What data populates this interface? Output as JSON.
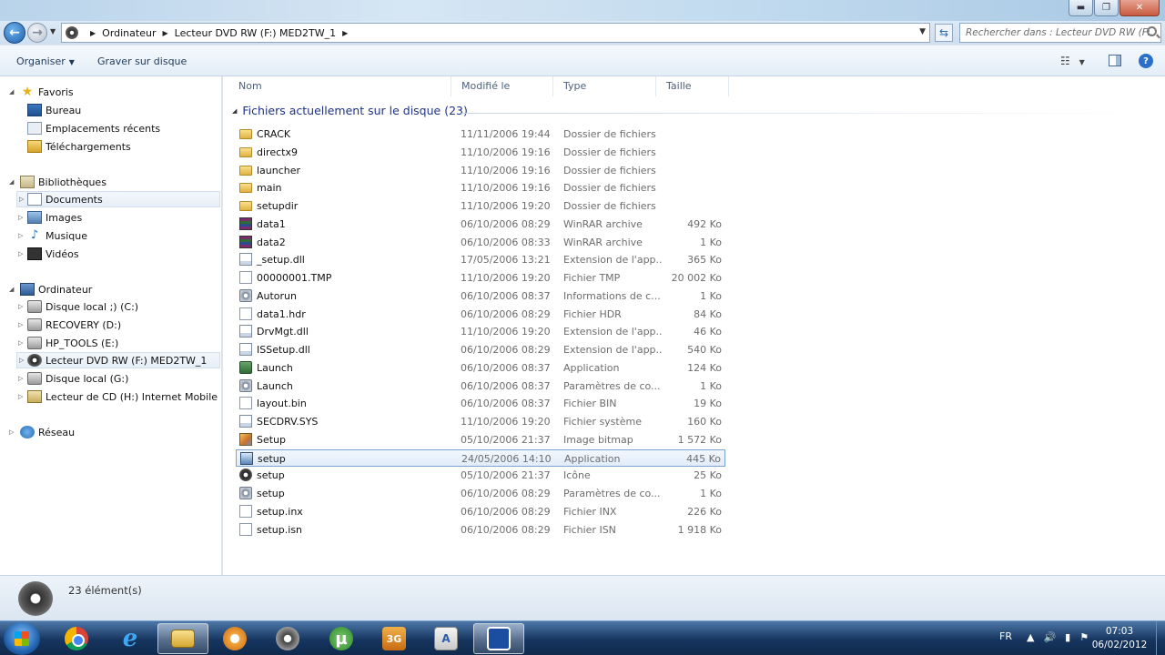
{
  "window": {
    "title_buttons": [
      "minimize",
      "maximize",
      "close"
    ]
  },
  "nav": {
    "breadcrumb": [
      "Ordinateur",
      "Lecteur DVD RW (F:) MED2TW_1"
    ],
    "search_placeholder": "Rechercher dans : Lecteur DVD RW (F:..."
  },
  "toolbar": {
    "organize_label": "Organiser",
    "burn_label": "Graver sur disque"
  },
  "sidebar": {
    "favorites": {
      "label": "Favoris",
      "items": [
        "Bureau",
        "Emplacements récents",
        "Téléchargements"
      ]
    },
    "libraries": {
      "label": "Bibliothèques",
      "items": [
        "Documents",
        "Images",
        "Musique",
        "Vidéos"
      ]
    },
    "computer": {
      "label": "Ordinateur",
      "items": [
        "Disque local ;) (C:)",
        "RECOVERY (D:)",
        "HP_TOOLS (E:)",
        "Lecteur DVD RW (F:) MED2TW_1",
        "Disque local (G:)",
        "Lecteur de CD (H:) Internet Mobile"
      ]
    },
    "network": {
      "label": "Réseau"
    }
  },
  "columns": {
    "name": "Nom",
    "modified": "Modifié le",
    "type": "Type",
    "size": "Taille"
  },
  "group": {
    "label": "Fichiers actuellement sur le disque (23)"
  },
  "files": [
    {
      "name": "CRACK",
      "date": "11/11/2006 19:44",
      "type": "Dossier de fichiers",
      "size": "",
      "icon": "folder"
    },
    {
      "name": "directx9",
      "date": "11/10/2006 19:16",
      "type": "Dossier de fichiers",
      "size": "",
      "icon": "folder"
    },
    {
      "name": "launcher",
      "date": "11/10/2006 19:16",
      "type": "Dossier de fichiers",
      "size": "",
      "icon": "folder"
    },
    {
      "name": "main",
      "date": "11/10/2006 19:16",
      "type": "Dossier de fichiers",
      "size": "",
      "icon": "folder"
    },
    {
      "name": "setupdir",
      "date": "11/10/2006 19:20",
      "type": "Dossier de fichiers",
      "size": "",
      "icon": "folder"
    },
    {
      "name": "data1",
      "date": "06/10/2006 08:29",
      "type": "WinRAR archive",
      "size": "492 Ko",
      "icon": "rar"
    },
    {
      "name": "data2",
      "date": "06/10/2006 08:33",
      "type": "WinRAR archive",
      "size": "1 Ko",
      "icon": "rar"
    },
    {
      "name": "_setup.dll",
      "date": "17/05/2006 13:21",
      "type": "Extension de l'app...",
      "size": "365 Ko",
      "icon": "dll"
    },
    {
      "name": "00000001.TMP",
      "date": "11/10/2006 19:20",
      "type": "Fichier TMP",
      "size": "20 002 Ko",
      "icon": "file"
    },
    {
      "name": "Autorun",
      "date": "06/10/2006 08:37",
      "type": "Informations de c...",
      "size": "1 Ko",
      "icon": "gear"
    },
    {
      "name": "data1.hdr",
      "date": "06/10/2006 08:29",
      "type": "Fichier HDR",
      "size": "84 Ko",
      "icon": "file"
    },
    {
      "name": "DrvMgt.dll",
      "date": "11/10/2006 19:20",
      "type": "Extension de l'app...",
      "size": "46 Ko",
      "icon": "dll"
    },
    {
      "name": "ISSetup.dll",
      "date": "06/10/2006 08:29",
      "type": "Extension de l'app...",
      "size": "540 Ko",
      "icon": "dll"
    },
    {
      "name": "Launch",
      "date": "06/10/2006 08:37",
      "type": "Application",
      "size": "124 Ko",
      "icon": "app"
    },
    {
      "name": "Launch",
      "date": "06/10/2006 08:37",
      "type": "Paramètres de co...",
      "size": "1 Ko",
      "icon": "gear"
    },
    {
      "name": "layout.bin",
      "date": "06/10/2006 08:37",
      "type": "Fichier BIN",
      "size": "19 Ko",
      "icon": "file"
    },
    {
      "name": "SECDRV.SYS",
      "date": "11/10/2006 19:20",
      "type": "Fichier système",
      "size": "160 Ko",
      "icon": "dll"
    },
    {
      "name": "Setup",
      "date": "05/10/2006 21:37",
      "type": "Image bitmap",
      "size": "1 572 Ko",
      "icon": "bmp"
    },
    {
      "name": "setup",
      "date": "24/05/2006 14:10",
      "type": "Application",
      "size": "445 Ko",
      "icon": "setup",
      "selected": true
    },
    {
      "name": "setup",
      "date": "05/10/2006 21:37",
      "type": "Icône",
      "size": "25 Ko",
      "icon": "ico"
    },
    {
      "name": "setup",
      "date": "06/10/2006 08:29",
      "type": "Paramètres de co...",
      "size": "1 Ko",
      "icon": "gear"
    },
    {
      "name": "setup.inx",
      "date": "06/10/2006 08:29",
      "type": "Fichier INX",
      "size": "226 Ko",
      "icon": "file"
    },
    {
      "name": "setup.isn",
      "date": "06/10/2006 08:29",
      "type": "Fichier ISN",
      "size": "1 918 Ko",
      "icon": "file"
    }
  ],
  "status": {
    "count_label": "23 élément(s)"
  },
  "taskbar": {
    "items": [
      "chrome",
      "internet-explorer",
      "windows-explorer",
      "media-player",
      "dvd-drive",
      "utorrent",
      "3g-manager",
      "document",
      "app"
    ],
    "ut_glyph": "µ",
    "threeg_glyph": "3G",
    "doc_glyph": "A",
    "language": "FR",
    "time": "07:03",
    "date": "06/02/2012"
  }
}
